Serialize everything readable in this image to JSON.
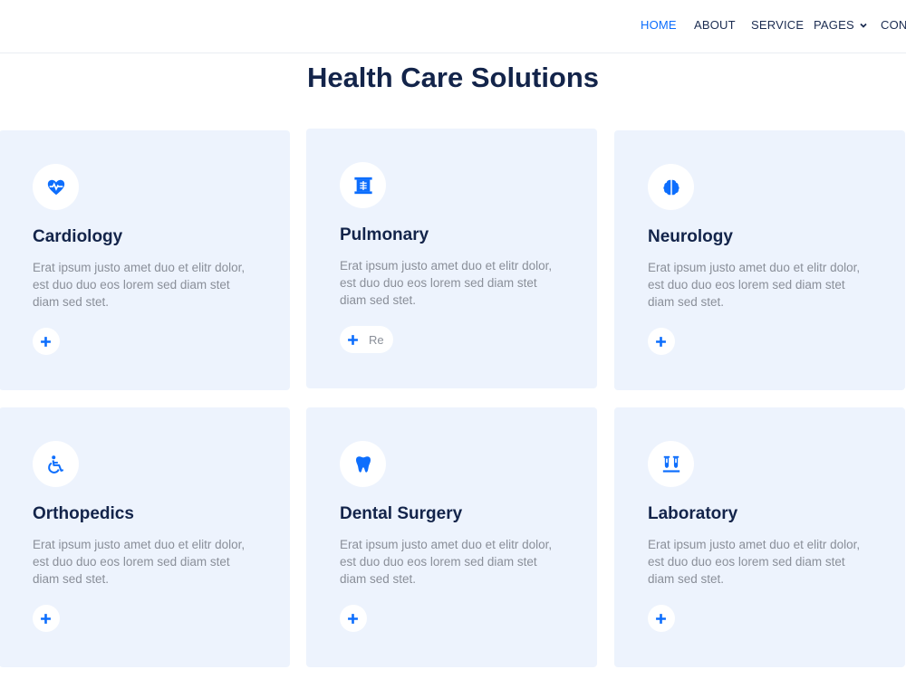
{
  "nav": {
    "items": [
      {
        "label": "HOME"
      },
      {
        "label": "ABOUT"
      },
      {
        "label": "SERVICE"
      },
      {
        "label": "PAGES"
      },
      {
        "label": "CONT"
      }
    ],
    "active_color": "#0d6efd",
    "text_color": "#1b2c51"
  },
  "section": {
    "title": "Health Care Solutions"
  },
  "services": [
    {
      "title": "Cardiology",
      "icon": "heartbeat-icon",
      "text": "Erat ipsum justo amet duo et elitr dolor, est duo duo eos lorem sed diam stet diam sed stet."
    },
    {
      "title": "Pulmonary",
      "icon": "x-ray-icon",
      "text": "Erat ipsum justo amet duo et elitr dolor, est duo duo eos lorem sed diam stet diam sed stet.",
      "more_label": "Re"
    },
    {
      "title": "Neurology",
      "icon": "brain-icon",
      "text": "Erat ipsum justo amet duo et elitr dolor, est duo duo eos lorem sed diam stet diam sed stet."
    },
    {
      "title": "Orthopedics",
      "icon": "wheelchair-icon",
      "text": "Erat ipsum justo amet duo et elitr dolor, est duo duo eos lorem sed diam stet diam sed stet."
    },
    {
      "title": "Dental Surgery",
      "icon": "tooth-icon",
      "text": "Erat ipsum justo amet duo et elitr dolor, est duo duo eos lorem sed diam stet diam sed stet."
    },
    {
      "title": "Laboratory",
      "icon": "vials-icon",
      "text": "Erat ipsum justo amet duo et elitr dolor, est duo duo eos lorem sed diam stet diam sed stet."
    }
  ],
  "colors": {
    "primary": "#0d6efd",
    "card_bg": "#edf3fd",
    "heading": "#13244a",
    "body_text": "#8a8f99"
  }
}
